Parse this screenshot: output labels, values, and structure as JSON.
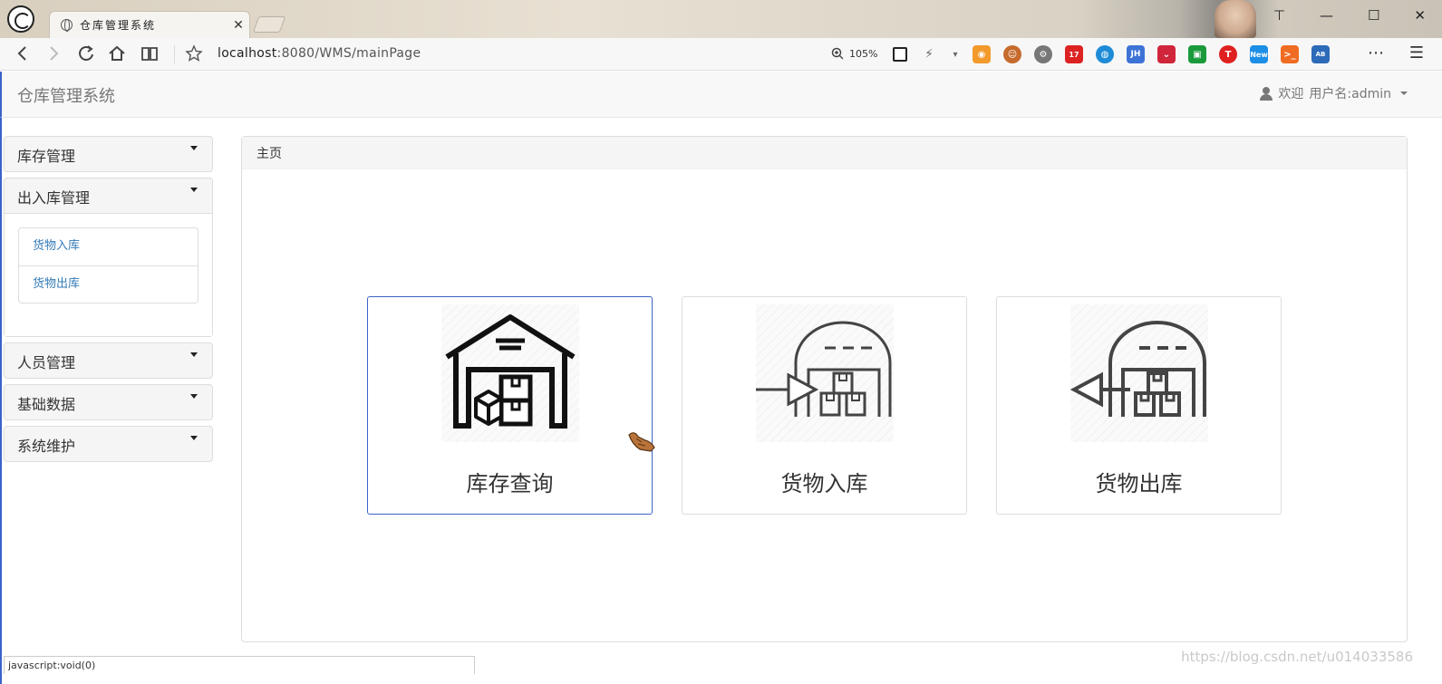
{
  "browser": {
    "tab_title": "仓库管理系统",
    "tab_close": "✕",
    "url_host": "localhost",
    "url_rest": ":8080/WMS/mainPage",
    "zoom": "105%",
    "more": "⋯",
    "menu": "☰",
    "window_buttons": [
      "⊤",
      "—",
      "☐",
      "✕"
    ],
    "extension_badge_new": "New",
    "extension_badge_count": "17",
    "extension_jh": "JH",
    "extension_abp": "AB"
  },
  "app": {
    "brand": "仓库管理系统",
    "welcome": "欢迎",
    "username": "用户名:admin"
  },
  "sidebar": {
    "panels": [
      {
        "title": "库存管理"
      },
      {
        "title": "出入库管理",
        "items": [
          "货物入库",
          "货物出库"
        ]
      },
      {
        "title": "人员管理"
      },
      {
        "title": "基础数据"
      },
      {
        "title": "系统维护"
      }
    ]
  },
  "main": {
    "heading": "主页",
    "cards": [
      {
        "label": "库存查询",
        "icon": "warehouse-icon"
      },
      {
        "label": "货物入库",
        "icon": "inbound-icon"
      },
      {
        "label": "货物出库",
        "icon": "outbound-icon"
      }
    ]
  },
  "status_text": "javascript:void(0)",
  "watermark": "https://blog.csdn.net/u014033586"
}
